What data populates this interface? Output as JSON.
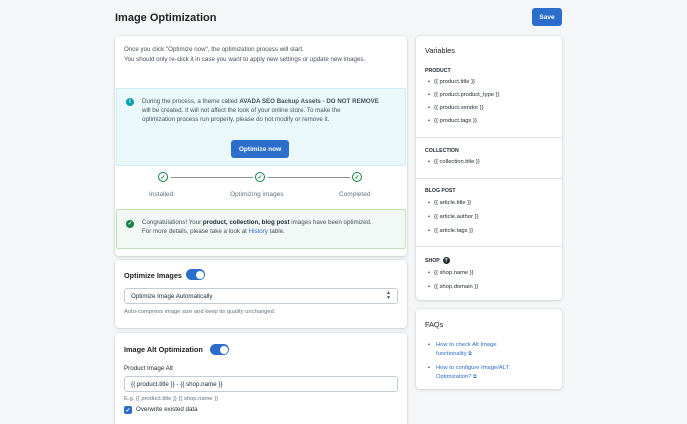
{
  "header": {
    "title": "Image Optimization",
    "save_label": "Save"
  },
  "optimization": {
    "intro_line1": "Once you click \"Optimize now\", the optimization process will start.",
    "intro_line2": "You should only re-click it in case you want to apply new settings or update new images.",
    "info": {
      "icon": "info-icon",
      "text_prefix": "During the process, a theme called ",
      "theme_name": "AVADA SEO Backup Assets - DO NOT REMOVE",
      "text_line2": "will be created. It will not affect the look of your online store. To make the",
      "text_line3": "optimization process run properly, please do not modify or remove it."
    },
    "optimize_button": "Optimize now",
    "steps": [
      {
        "label": "Installed",
        "icon": "check-circle-icon"
      },
      {
        "label": "Optimizing images",
        "icon": "check-circle-icon"
      },
      {
        "label": "Completed",
        "icon": "check-circle-icon"
      }
    ],
    "success": {
      "icon": "check-circle-filled-icon",
      "part1": "Congratulations! Your ",
      "bold": "product, collection, blog post",
      "part2": " images have been optimized.",
      "line2_prefix": "For more details, please take a look at ",
      "history_link": "History",
      "line2_suffix": " table."
    }
  },
  "optimize_images": {
    "title": "Optimize Images",
    "toggle_on": true,
    "select_value": "Optimize Image Automatically",
    "help": "Auto-compress image size and keep its quality unchanged."
  },
  "alt_optimization": {
    "title": "Image Alt Optimization",
    "toggle_on": true,
    "field_label": "Product Image Alt",
    "field_value": "{{ product.title }} - {{ shop.name }}",
    "example": "E.g. {{ product.title }} {{ shop.name }}",
    "checkbox_checked": true,
    "checkbox_label": "Overwrite existed data"
  },
  "variables": {
    "title": "Variables",
    "groups": [
      {
        "title": "PRODUCT",
        "items": [
          "{{ product.title }}",
          "{{ product.product_type }}",
          "{{ product.vendor }}",
          "{{ product.tags }}"
        ]
      },
      {
        "title": "COLLECTION",
        "items": [
          "{{ collection.title }}"
        ]
      },
      {
        "title": "BLOG POST",
        "items": [
          "{{ article.title }}",
          "{{ article.author }}",
          "{{ article.tags }}"
        ]
      },
      {
        "title": "SHOP",
        "items": [
          "{{ shop.name }}",
          "{{ shop.domain }}"
        ]
      }
    ]
  },
  "faqs": {
    "title": "FAQs",
    "items": [
      {
        "line1": "How to check Alt Image",
        "line2": "functionality"
      },
      {
        "line1": "How to configure Image/ALT",
        "line2": "Optimization?"
      }
    ]
  },
  "colors": {
    "primary": "#2c6ecb",
    "success": "#108043",
    "info_bg": "#ebf9fc",
    "success_bg": "#f1f8f5",
    "page_bg": "#f4f6f8"
  }
}
